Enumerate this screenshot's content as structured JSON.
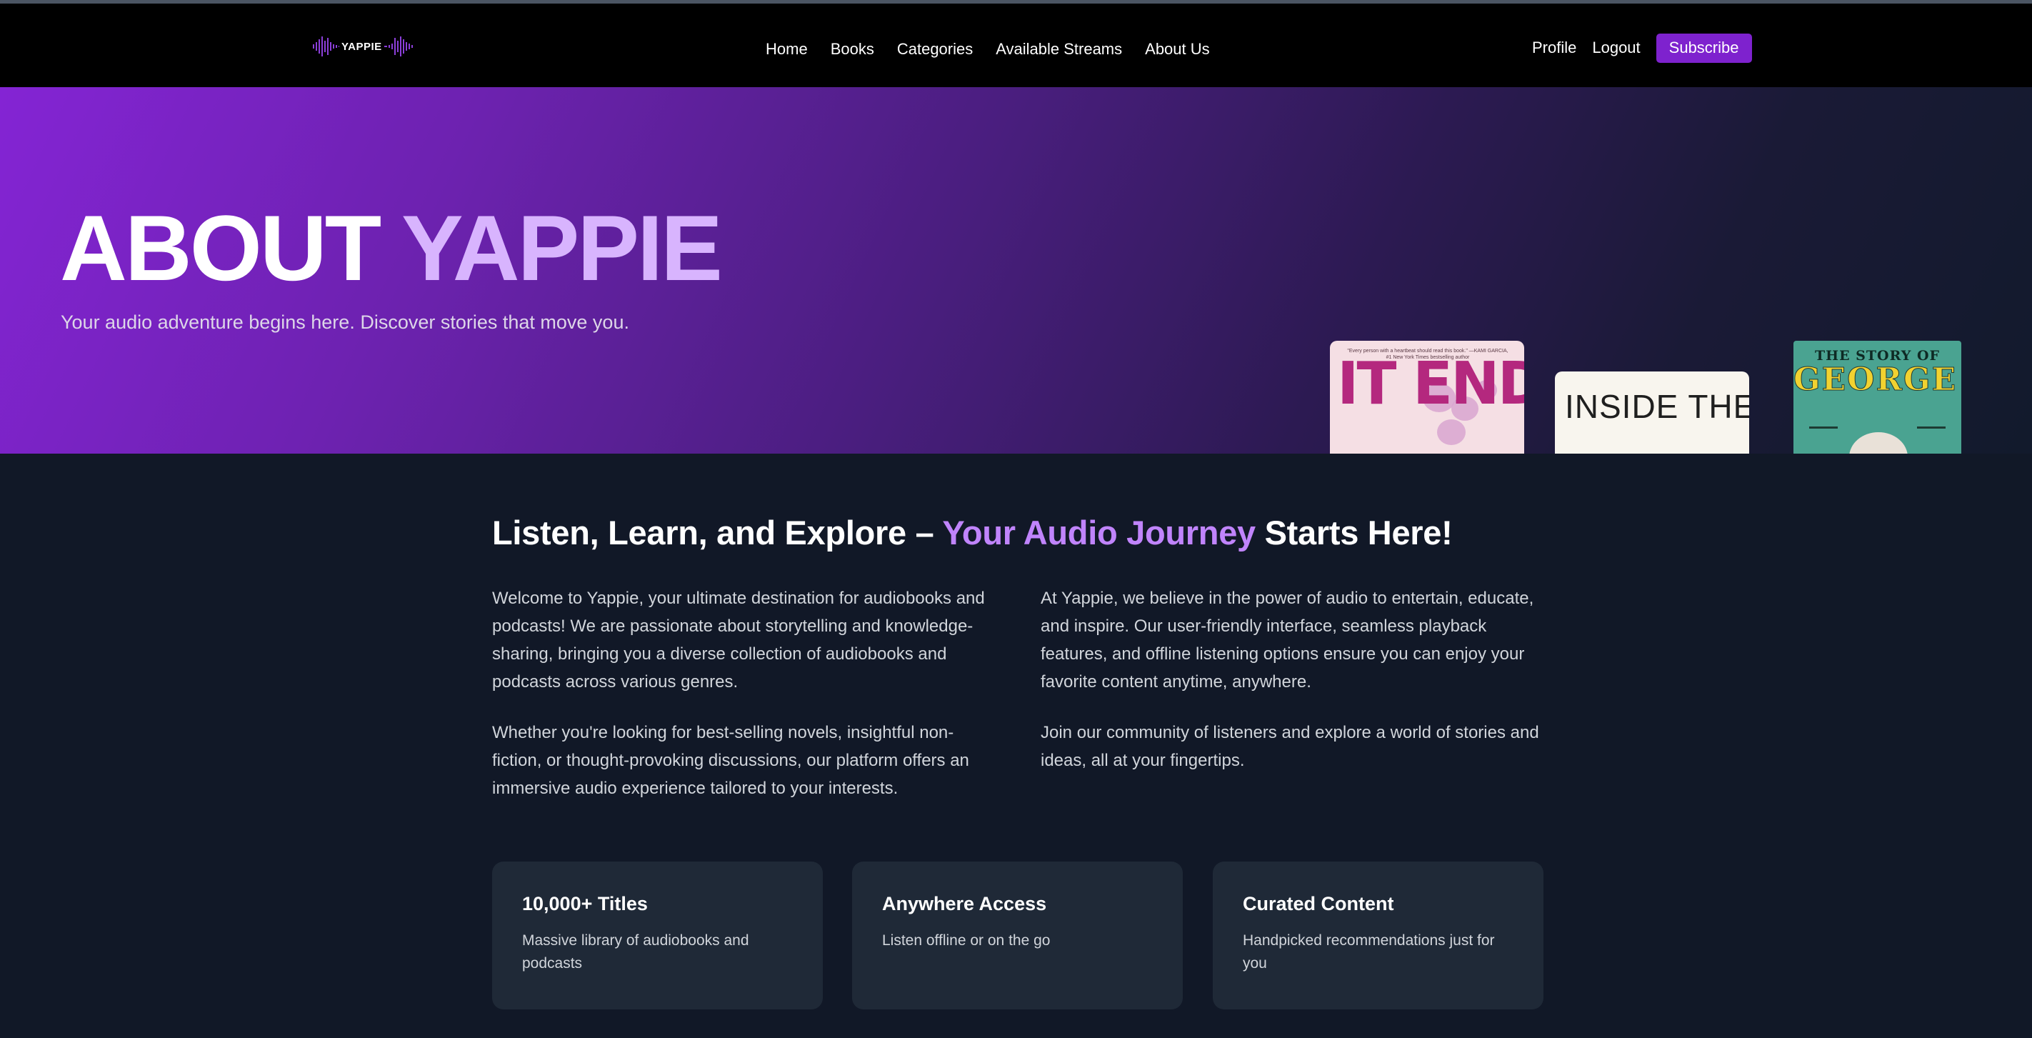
{
  "brand": {
    "logo_text": "YAPPIE",
    "logo_icon": "sound-wave-icon",
    "accent_color": "#7e22ce",
    "highlight_color": "#d8b4fe"
  },
  "nav": {
    "links": [
      "Home",
      "Books",
      "Categories",
      "Available Streams",
      "About Us"
    ],
    "profile": "Profile",
    "logout": "Logout",
    "subscribe": "Subscribe"
  },
  "hero": {
    "title_main": "ABOUT",
    "title_accent": "YAPPIE",
    "subtitle": "Your audio adventure begins here. Discover stories that move you.",
    "books": [
      {
        "cover_blurb": "\"Every person with a heartbeat should read this book.\" —KAMI GARCIA, #1 New York Times bestselling author",
        "title": "IT ENDS WITH"
      },
      {
        "title": "INSIDE THE POLITICAL"
      },
      {
        "series": "THE STORY OF",
        "title": "GEORGE WASHINGTON"
      }
    ]
  },
  "about": {
    "heading_start": "Listen, Learn, and Explore – ",
    "heading_accent": "Your Audio Journey",
    "heading_end": " Starts Here!",
    "paragraphs": [
      "Welcome to Yappie, your ultimate destination for audiobooks and podcasts! We are passionate about storytelling and knowledge-sharing, bringing you a diverse collection of audiobooks and podcasts across various genres.",
      "Whether you're looking for best-selling novels, insightful non-fiction, or thought-provoking discussions, our platform offers an immersive audio experience tailored to your interests.",
      "At Yappie, we believe in the power of audio to entertain, educate, and inspire. Our user-friendly interface, seamless playback features, and offline listening options ensure you can enjoy your favorite content anytime, anywhere.",
      "Join our community of listeners and explore a world of stories and ideas, all at your fingertips."
    ]
  },
  "features": [
    {
      "title": "10,000+ Titles",
      "description": "Massive library of audiobooks and podcasts"
    },
    {
      "title": "Anywhere Access",
      "description": "Listen offline or on the go"
    },
    {
      "title": "Curated Content",
      "description": "Handpicked recommendations just for you"
    }
  ]
}
